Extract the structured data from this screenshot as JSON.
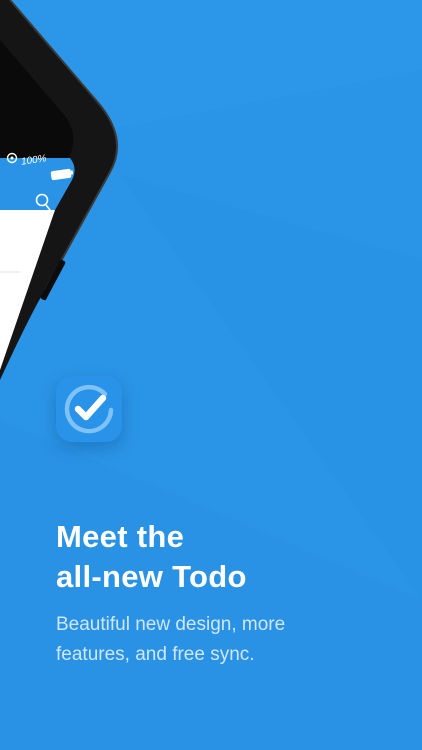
{
  "colors": {
    "background": "#2a95e6",
    "background_light": "#36a0ee",
    "background_dark": "#1f88dc",
    "phone_frame": "#111111",
    "app_bar": "#2b93e6",
    "icon_bg": "#2893e8"
  },
  "phone": {
    "status_battery": "100%",
    "status_icons": [
      "orientation-lock-icon",
      "battery-icon"
    ],
    "toolbar_icon": "search-icon"
  },
  "app_icon": {
    "icon": "check-circle-icon"
  },
  "headline": {
    "line1": "Meet the",
    "line2": "all-new Todo"
  },
  "subtext": {
    "line1": "Beautiful new design, more",
    "line2": "features, and free sync."
  }
}
